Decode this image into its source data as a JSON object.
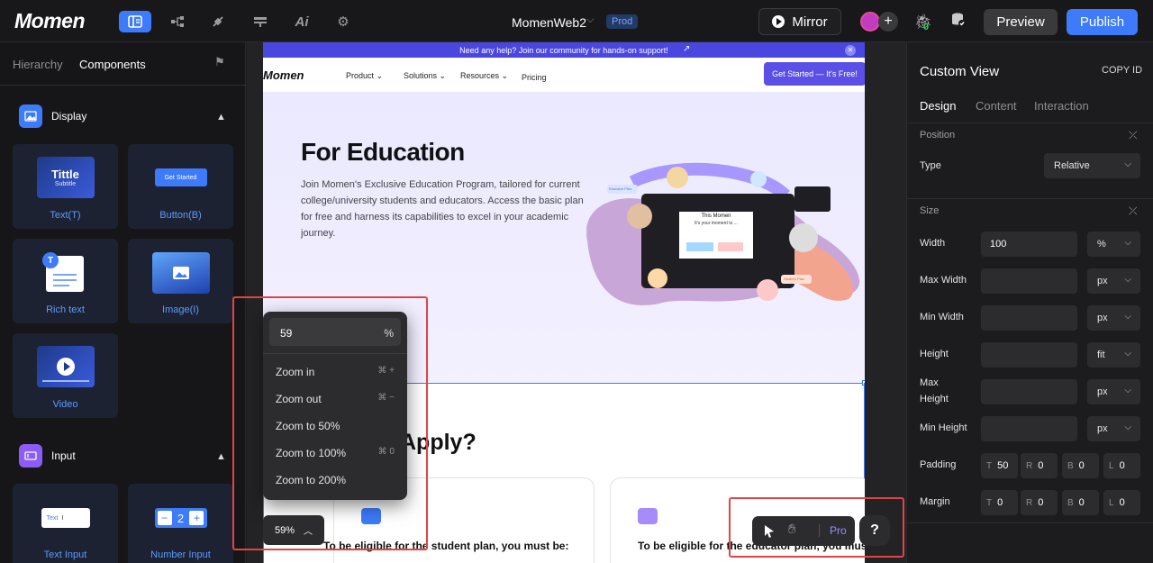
{
  "topbar": {
    "logo_text": "Momen",
    "project_name": "MomenWeb2",
    "env_badge": "Prod",
    "mirror_label": "Mirror",
    "bug_count": "0",
    "preview_label": "Preview",
    "publish_label": "Publish",
    "icons": [
      "components-icon",
      "tree-icon",
      "plug-icon",
      "data-icon",
      "ai-icon",
      "gear-icon"
    ]
  },
  "left_panel": {
    "tabs": [
      "Hierarchy",
      "Components"
    ],
    "active_tab": "Components",
    "display_section": {
      "title": "Display",
      "items": [
        {
          "label": "Text(T)",
          "preview_title": "Tittle",
          "preview_subtitle": "Subtitle"
        },
        {
          "label": "Button(B)",
          "preview_text": "Get Started"
        },
        {
          "label": "Rich text",
          "preview_badge": "T"
        },
        {
          "label": "Image(I)"
        },
        {
          "label": "Video"
        }
      ]
    },
    "input_section": {
      "title": "Input",
      "items": [
        {
          "label": "Text Input",
          "preview_text": "Text"
        },
        {
          "label": "Number Input",
          "preview_value": "2"
        }
      ]
    }
  },
  "canvas": {
    "banner_text": "Need any help? Join our community for hands-on support!",
    "nav": {
      "logo": "Momen",
      "items": [
        "Product",
        "Solutions",
        "Resources",
        "Pricing"
      ],
      "cta": "Get Started — It's Free!"
    },
    "hero": {
      "title": "For Education",
      "description": "Join Momen's Exclusive Education Program, tailored for current college/university students and educators. Access the basic plan for free and harness its capabilities to excel in your academic journey.",
      "mock_title": "This Momen",
      "mock_subtitle": "It's your moment to ...",
      "tag_left": "Educator Plan",
      "tag_right": "Student Plan"
    },
    "apply_heading": "Apply?",
    "cards": [
      {
        "text": "To be eligible for the student plan, you must be:",
        "icon_color": "#3d7bfa"
      },
      {
        "text": "To be eligible for the educator plan, you mus",
        "icon_color": "#a78bfa"
      }
    ]
  },
  "zoom": {
    "value": "59",
    "unit": "%",
    "items": [
      {
        "label": "Zoom in",
        "shortcut": "⌘ +"
      },
      {
        "label": "Zoom out",
        "shortcut": "⌘ −"
      },
      {
        "label": "Zoom to 50%",
        "shortcut": ""
      },
      {
        "label": "Zoom to 100%",
        "shortcut": "⌘ 0"
      },
      {
        "label": "Zoom to 200%",
        "shortcut": ""
      }
    ],
    "pill_label": "59%"
  },
  "toolbar": {
    "pro_label": "Pro",
    "help_label": "?"
  },
  "right_panel": {
    "title": "Custom View",
    "copy_id": "COPY ID",
    "tabs": [
      "Design",
      "Content",
      "Interaction"
    ],
    "active_tab": "Design",
    "position": {
      "section": "Position",
      "type_label": "Type",
      "type_value": "Relative"
    },
    "size": {
      "section": "Size",
      "rows": [
        {
          "label": "Width",
          "value": "100",
          "unit": "%"
        },
        {
          "label": "Max Width",
          "value": "",
          "unit": "px"
        },
        {
          "label": "Min Width",
          "value": "",
          "unit": "px"
        },
        {
          "label": "Height",
          "value": "",
          "unit": "fit"
        },
        {
          "label": "Max Height",
          "value": "",
          "unit": "px"
        },
        {
          "label": "Min Height",
          "value": "",
          "unit": "px"
        }
      ]
    },
    "padding": {
      "label": "Padding",
      "T": "50",
      "R": "0",
      "B": "0",
      "L": "0"
    },
    "margin": {
      "label": "Margin",
      "T": "0",
      "R": "0",
      "B": "0",
      "L": "0"
    }
  },
  "colors": {
    "accent": "#3d7bfa",
    "highlight": "#e04545",
    "cta_purple": "#5b4fe8"
  }
}
